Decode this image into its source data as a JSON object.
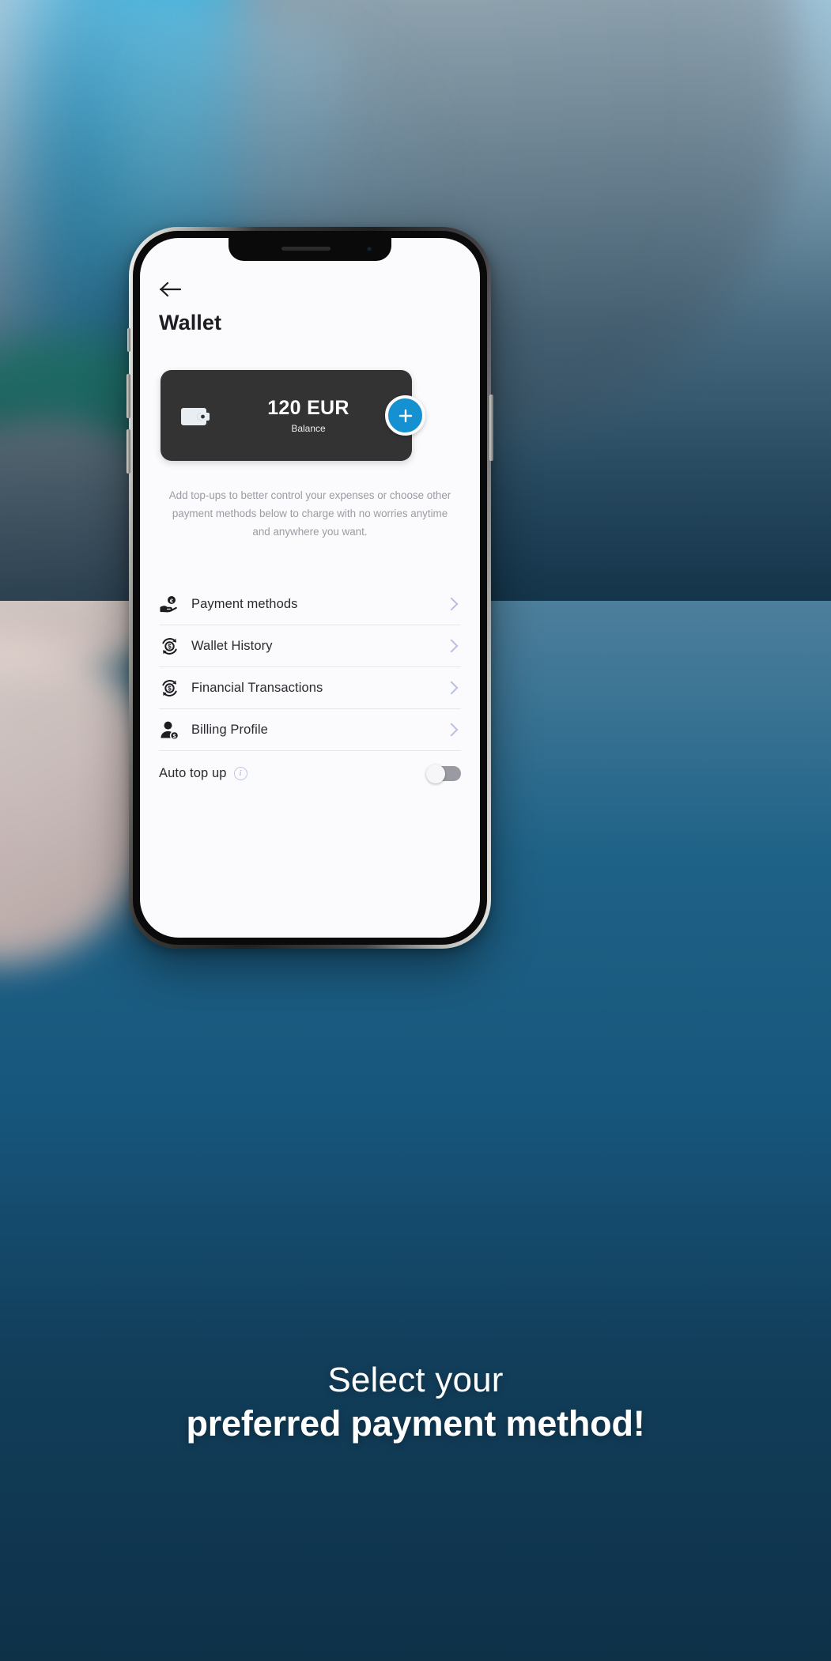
{
  "background": {
    "accent_cyan": "#57c6e8",
    "accent_green": "#3fd09a",
    "deep_blue": "#17506f"
  },
  "phone": {
    "notch": {
      "speaker_name": "earpiece-speaker",
      "camera_name": "front-camera"
    },
    "side_buttons": [
      "silent-switch",
      "volume-up-button",
      "volume-down-button",
      "power-button"
    ]
  },
  "screen": {
    "header": {
      "back_icon": "back-arrow-icon",
      "title": "Wallet"
    },
    "balance_card": {
      "wallet_icon": "wallet-icon",
      "amount": "120 EUR",
      "label": "Balance",
      "card_color": "#333334",
      "add_button": {
        "icon": "plus-icon",
        "color": "#1590d0"
      }
    },
    "description": "Add top-ups to better control your expenses or choose other payment methods below to charge with no worries anytime and anywhere you want.",
    "menu": [
      {
        "label": "Payment methods",
        "icon": "hand-euro-coin-icon",
        "chevron": "chevron-right-icon"
      },
      {
        "label": "Wallet History",
        "icon": "refresh-dollar-coin-icon",
        "chevron": "chevron-right-icon"
      },
      {
        "label": "Financial Transactions",
        "icon": "refresh-dollar-coin-icon",
        "chevron": "chevron-right-icon"
      },
      {
        "label": "Billing Profile",
        "icon": "person-dollar-badge-icon",
        "chevron": "chevron-right-icon"
      }
    ],
    "auto_top_up": {
      "label": "Auto top up",
      "info_icon": "info-icon",
      "info_glyph": "i",
      "toggle_state": "off",
      "toggle_name": "auto-top-up-toggle"
    }
  },
  "caption": {
    "line1": "Select your",
    "line2": "preferred payment method!"
  }
}
